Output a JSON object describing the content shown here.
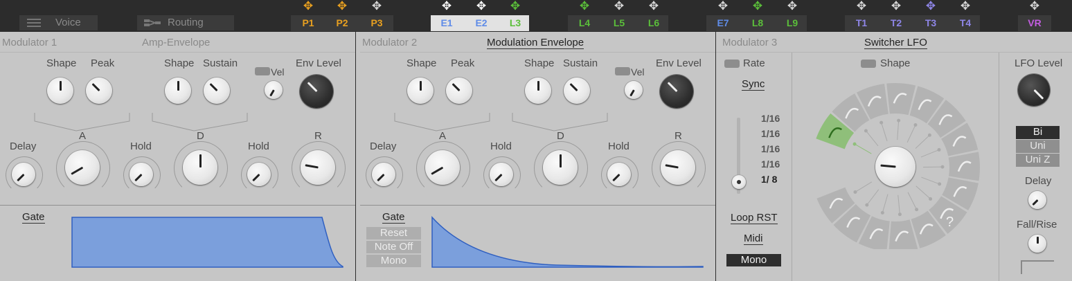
{
  "topbar": {
    "voice_label": "Voice",
    "routing_label": "Routing",
    "slots": [
      {
        "label": "P1",
        "color": "#e8a020"
      },
      {
        "label": "P2",
        "color": "#e8a020"
      },
      {
        "label": "P3",
        "color": "#e8a020"
      },
      {
        "label": "E1",
        "color": "#5f8ce8"
      },
      {
        "label": "E2",
        "color": "#5f8ce8"
      },
      {
        "label": "L3",
        "color": "#5bbf3a"
      },
      {
        "label": "L4",
        "color": "#5bbf3a"
      },
      {
        "label": "L5",
        "color": "#5bbf3a"
      },
      {
        "label": "L6",
        "color": "#5bbf3a"
      },
      {
        "label": "E7",
        "color": "#5f8ce8"
      },
      {
        "label": "L8",
        "color": "#5bbf3a"
      },
      {
        "label": "L9",
        "color": "#5bbf3a"
      },
      {
        "label": "T1",
        "color": "#8f86e8"
      },
      {
        "label": "T2",
        "color": "#8f86e8"
      },
      {
        "label": "T3",
        "color": "#8f86e8"
      },
      {
        "label": "T4",
        "color": "#8f86e8"
      },
      {
        "label": "VR",
        "color": "#c25de0"
      }
    ],
    "move_icon_glyph": "✥"
  },
  "mod1": {
    "title": "Modulator 1",
    "env_title": "Amp-Envelope",
    "labels": {
      "shape1": "Shape",
      "peak": "Peak",
      "shape2": "Shape",
      "sustain": "Sustain",
      "vel": "Vel",
      "env_level": "Env Level",
      "delay": "Delay",
      "a": "A",
      "hold1": "Hold",
      "d": "D",
      "hold2": "Hold",
      "r": "R"
    },
    "gate_label": "Gate"
  },
  "mod2": {
    "title": "Modulator 2",
    "env_title": "Modulation Envelope",
    "labels": {
      "shape1": "Shape",
      "peak": "Peak",
      "shape2": "Shape",
      "sustain": "Sustain",
      "vel": "Vel",
      "env_level": "Env Level",
      "delay": "Delay",
      "a": "A",
      "hold1": "Hold",
      "d": "D",
      "hold2": "Hold",
      "r": "R"
    },
    "gate_label": "Gate",
    "trigger_options": [
      "Reset",
      "Note Off",
      "Mono"
    ]
  },
  "mod3": {
    "title": "Modulator 3",
    "lfo_title": "Switcher LFO",
    "rate_label": "Rate",
    "shape_label": "Shape",
    "sync_label": "Sync",
    "sync_values": [
      "1/16",
      "1/16",
      "1/16",
      "1/16",
      "1/ 8"
    ],
    "loop_rst_label": "Loop RST",
    "midi_label": "Midi",
    "mono_label": "Mono",
    "lfo_level_label": "LFO Level",
    "polarity_options": [
      "Bi",
      "Uni",
      "Uni Z"
    ],
    "delay_label": "Delay",
    "fall_rise_label": "Fall/Rise",
    "unknown_shape_glyph": "?"
  },
  "colors": {
    "envelope_fill": "#7b9fdc",
    "envelope_stroke": "#2f5fc0",
    "selected_shape": "#8fbf7a"
  }
}
